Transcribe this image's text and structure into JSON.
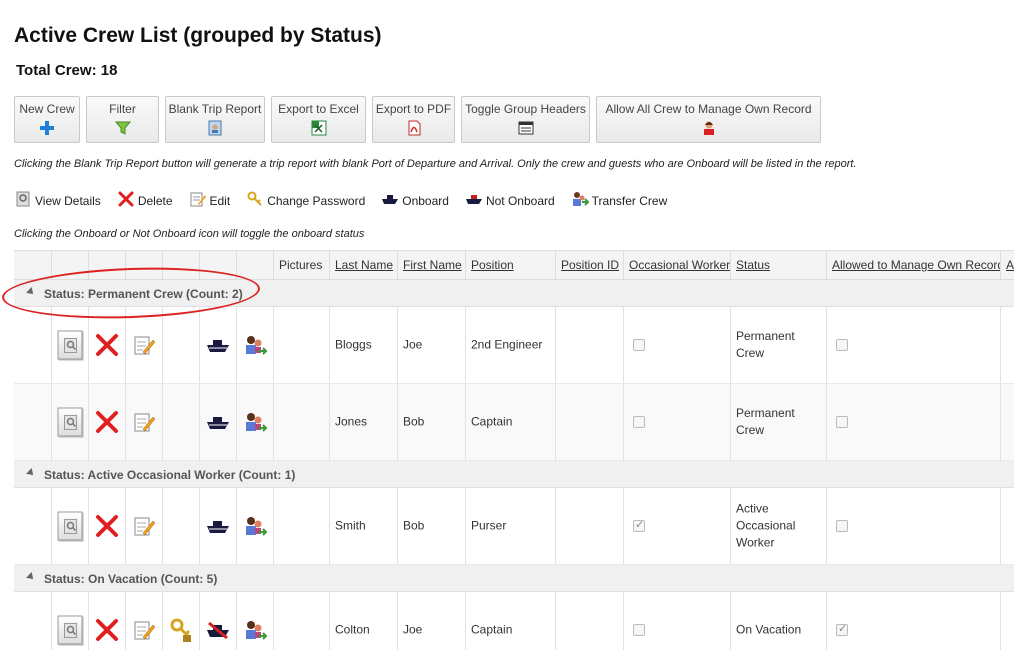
{
  "page": {
    "title": "Active Crew List (grouped by Status)",
    "total": "Total Crew: 18"
  },
  "toolbar": [
    {
      "label": "New Crew",
      "icon": "plus-icon"
    },
    {
      "label": "Filter",
      "icon": "filter-icon"
    },
    {
      "label": "Blank Trip Report",
      "icon": "report-icon"
    },
    {
      "label": "Export to Excel",
      "icon": "excel-icon"
    },
    {
      "label": "Export to PDF",
      "icon": "pdf-icon"
    },
    {
      "label": "Toggle Group Headers",
      "icon": "headers-icon"
    },
    {
      "label": "Allow All Crew to Manage Own Record",
      "icon": "user-icon"
    }
  ],
  "notes": {
    "blank_trip": "Clicking the Blank Trip Report button will generate a trip report with blank Port of Departure and Arrival. Only the crew and guests who are Onboard will be listed in the report.",
    "onboard_toggle": "Clicking the Onboard or Not Onboard icon will toggle the onboard status"
  },
  "legend": [
    {
      "label": "View Details",
      "icon": "view-details-icon"
    },
    {
      "label": "Delete",
      "icon": "delete-icon"
    },
    {
      "label": "Edit",
      "icon": "edit-icon"
    },
    {
      "label": "Change Password",
      "icon": "key-icon"
    },
    {
      "label": "Onboard",
      "icon": "ship-icon"
    },
    {
      "label": "Not Onboard",
      "icon": "ship-red-icon"
    },
    {
      "label": "Transfer Crew",
      "icon": "transfer-icon"
    }
  ],
  "columns": {
    "pictures": "Pictures",
    "last_name": "Last Name",
    "first_name": "First Name",
    "position": "Position",
    "position_id": "Position ID",
    "occasional": "Occasional Worker",
    "status": "Status",
    "allowed": "Allowed to Manage Own Record",
    "partial": "A"
  },
  "groups": [
    {
      "label": "Status: Permanent Crew (Count: 2)",
      "rows": [
        {
          "last": "Bloggs",
          "first": "Joe",
          "position": "2nd Engineer",
          "status": "Permanent Crew",
          "occasional": false,
          "allowed": false,
          "onboard": true,
          "password": false
        },
        {
          "last": "Jones",
          "first": "Bob",
          "position": "Captain",
          "status": "Permanent Crew",
          "occasional": false,
          "allowed": false,
          "onboard": true,
          "password": false
        }
      ]
    },
    {
      "label": "Status: Active Occasional Worker (Count: 1)",
      "rows": [
        {
          "last": "Smith",
          "first": "Bob",
          "position": "Purser",
          "status": "Active Occasional Worker",
          "occasional": true,
          "allowed": false,
          "onboard": true,
          "password": false
        }
      ]
    },
    {
      "label": "Status: On Vacation (Count: 5)",
      "rows": [
        {
          "last": "Colton",
          "first": "Joe",
          "position": "Captain",
          "status": "On Vacation",
          "occasional": false,
          "allowed": true,
          "onboard": false,
          "password": true
        }
      ]
    }
  ],
  "colors": {
    "annotation": "#dd2222",
    "delete": "#e02020",
    "ship": "#1a1a40"
  }
}
